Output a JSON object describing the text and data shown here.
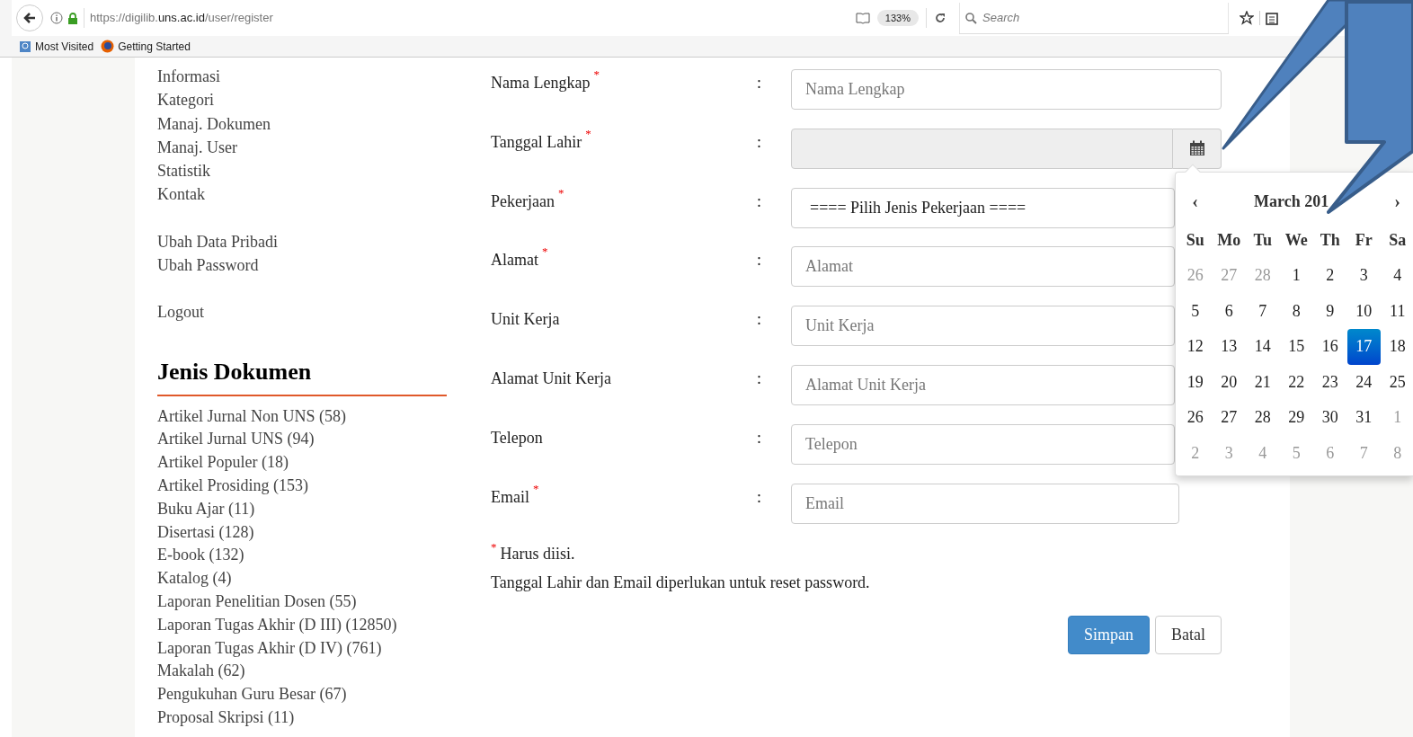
{
  "browser": {
    "url_prefix": "https://digilib.",
    "url_host": "uns.ac.id",
    "url_path": "/user/register",
    "zoom": "133%",
    "search_placeholder": "Search",
    "bookmarks": [
      "Most Visited",
      "Getting Started"
    ]
  },
  "sidebar": {
    "menu_groups": [
      [
        "Informasi",
        "Kategori",
        "Manaj. Dokumen",
        "Manaj. User",
        "Statistik",
        "Kontak"
      ],
      [
        "Ubah Data Pribadi",
        "Ubah Password"
      ],
      [
        "Logout"
      ]
    ],
    "section_title": "Jenis Dokumen",
    "documents": [
      "Artikel Jurnal Non UNS (58)",
      "Artikel Jurnal UNS (94)",
      "Artikel Populer (18)",
      "Artikel Prosiding (153)",
      "Buku Ajar (11)",
      "Disertasi (128)",
      "E-book (132)",
      "Katalog (4)",
      "Laporan Penelitian Dosen (55)",
      "Laporan Tugas Akhir (D III) (12850)",
      "Laporan Tugas Akhir (D IV) (761)",
      "Makalah (62)",
      "Pengukuhan Guru Besar (67)",
      "Proposal Skripsi (11)"
    ]
  },
  "form": {
    "fields": [
      {
        "label": "Nama Lengkap",
        "required": true,
        "kind": "text",
        "placeholder": "Nama Lengkap"
      },
      {
        "label": "Tanggal Lahir",
        "required": true,
        "kind": "date",
        "disabled": true
      },
      {
        "label": "Pekerjaan",
        "required": true,
        "kind": "select",
        "value": "==== Pilih Jenis Pekerjaan ===="
      },
      {
        "label": "Alamat",
        "required": true,
        "kind": "text",
        "placeholder": "Alamat"
      },
      {
        "label": "Unit Kerja",
        "required": false,
        "kind": "text",
        "placeholder": "Unit Kerja"
      },
      {
        "label": "Alamat Unit Kerja",
        "required": false,
        "kind": "text",
        "placeholder": "Alamat Unit Kerja"
      },
      {
        "label": "Telepon",
        "required": false,
        "kind": "text",
        "placeholder": "Telepon"
      },
      {
        "label": "Email",
        "required": true,
        "kind": "text",
        "placeholder": "Email"
      }
    ],
    "separator": ":",
    "required_mark": "*",
    "required_note": "Harus diisi.",
    "info_note": "Tanggal Lahir dan Email diperlukan untuk reset password.",
    "buttons": [
      {
        "label": "Simpan",
        "kind": "primary"
      },
      {
        "label": "Batal",
        "kind": "default"
      }
    ]
  },
  "datepicker": {
    "prev": "‹",
    "title": "March 201",
    "next": "›",
    "weekdays": [
      "Su",
      "Mo",
      "Tu",
      "We",
      "Th",
      "Fr",
      "Sa"
    ],
    "weeks": [
      [
        {
          "day": "26",
          "other_month": true,
          "selected": false
        },
        {
          "day": "27",
          "other_month": true,
          "selected": false
        },
        {
          "day": "28",
          "other_month": true,
          "selected": false
        },
        {
          "day": "1",
          "other_month": false,
          "selected": false
        },
        {
          "day": "2",
          "other_month": false,
          "selected": false
        },
        {
          "day": "3",
          "other_month": false,
          "selected": false
        },
        {
          "day": "4",
          "other_month": false,
          "selected": false
        }
      ],
      [
        {
          "day": "5",
          "other_month": false,
          "selected": false
        },
        {
          "day": "6",
          "other_month": false,
          "selected": false
        },
        {
          "day": "7",
          "other_month": false,
          "selected": false
        },
        {
          "day": "8",
          "other_month": false,
          "selected": false
        },
        {
          "day": "9",
          "other_month": false,
          "selected": false
        },
        {
          "day": "10",
          "other_month": false,
          "selected": false
        },
        {
          "day": "11",
          "other_month": false,
          "selected": false
        }
      ],
      [
        {
          "day": "12",
          "other_month": false,
          "selected": false
        },
        {
          "day": "13",
          "other_month": false,
          "selected": false
        },
        {
          "day": "14",
          "other_month": false,
          "selected": false
        },
        {
          "day": "15",
          "other_month": false,
          "selected": false
        },
        {
          "day": "16",
          "other_month": false,
          "selected": false
        },
        {
          "day": "17",
          "other_month": false,
          "selected": true
        },
        {
          "day": "18",
          "other_month": false,
          "selected": false
        }
      ],
      [
        {
          "day": "19",
          "other_month": false,
          "selected": false
        },
        {
          "day": "20",
          "other_month": false,
          "selected": false
        },
        {
          "day": "21",
          "other_month": false,
          "selected": false
        },
        {
          "day": "22",
          "other_month": false,
          "selected": false
        },
        {
          "day": "23",
          "other_month": false,
          "selected": false
        },
        {
          "day": "24",
          "other_month": false,
          "selected": false
        },
        {
          "day": "25",
          "other_month": false,
          "selected": false
        }
      ],
      [
        {
          "day": "26",
          "other_month": false,
          "selected": false
        },
        {
          "day": "27",
          "other_month": false,
          "selected": false
        },
        {
          "day": "28",
          "other_month": false,
          "selected": false
        },
        {
          "day": "29",
          "other_month": false,
          "selected": false
        },
        {
          "day": "30",
          "other_month": false,
          "selected": false
        },
        {
          "day": "31",
          "other_month": false,
          "selected": false
        },
        {
          "day": "1",
          "other_month": true,
          "selected": false
        }
      ],
      [
        {
          "day": "2",
          "other_month": true,
          "selected": false
        },
        {
          "day": "3",
          "other_month": true,
          "selected": false
        },
        {
          "day": "4",
          "other_month": true,
          "selected": false
        },
        {
          "day": "5",
          "other_month": true,
          "selected": false
        },
        {
          "day": "6",
          "other_month": true,
          "selected": false
        },
        {
          "day": "7",
          "other_month": true,
          "selected": false
        },
        {
          "day": "8",
          "other_month": true,
          "selected": false
        }
      ]
    ]
  }
}
